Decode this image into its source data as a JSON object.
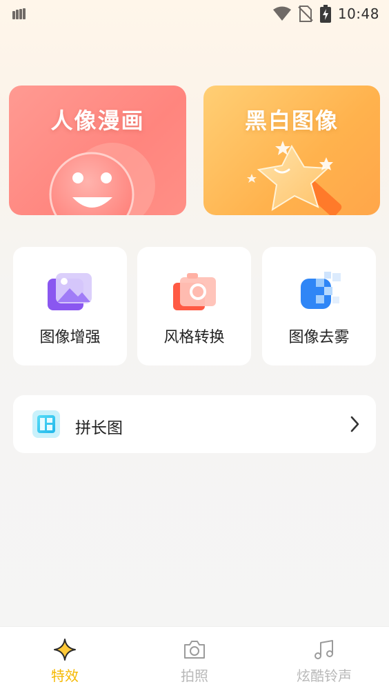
{
  "status_bar": {
    "time": "10:48",
    "icons": [
      "sim-card-icon",
      "wifi-icon",
      "no-sim-icon",
      "battery-charging-icon"
    ]
  },
  "feature_cards": [
    {
      "label": "人像漫画",
      "icon": "smiley-face-icon",
      "color": "#ff8f86"
    },
    {
      "label": "黑白图像",
      "icon": "star-wand-icon",
      "color": "#ffb24d"
    }
  ],
  "tools": [
    {
      "label": "图像增强",
      "icon": "image-enhance-icon",
      "color": "#9b6cf2"
    },
    {
      "label": "风格转换",
      "icon": "camera-style-icon",
      "color": "#ff6b57"
    },
    {
      "label": "图像去雾",
      "icon": "dehaze-icon",
      "color": "#3b8ef8"
    }
  ],
  "long_image": {
    "label": "拼长图",
    "icon": "collage-icon",
    "color": "#2ec8f0"
  },
  "bottom_nav": [
    {
      "label": "特效",
      "icon": "sparkle-icon",
      "active": true
    },
    {
      "label": "拍照",
      "icon": "camera-icon",
      "active": false
    },
    {
      "label": "炫酷铃声",
      "icon": "music-note-icon",
      "active": false
    }
  ],
  "accent_color": "#f5b800"
}
